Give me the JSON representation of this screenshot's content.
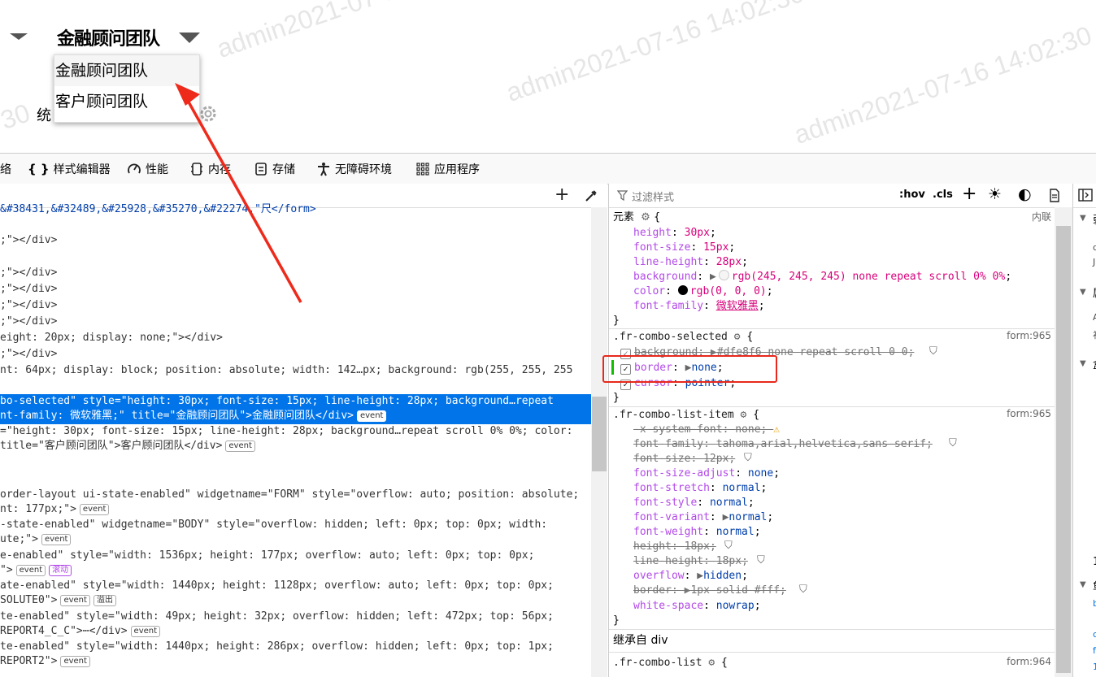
{
  "app": {
    "watermark": "admin2021-07-16 14:02:30",
    "watermark_fragment": "30",
    "combo_title": "金融顾问团队",
    "combo_options": [
      "金融顾问团队",
      "客户顾问团队"
    ],
    "stat_label_partial": "统"
  },
  "devtools": {
    "tabs": [
      {
        "label": "络",
        "icon": "network-icon"
      },
      {
        "label": "样式编辑器",
        "icon": "style-editor-icon"
      },
      {
        "label": "性能",
        "icon": "performance-icon"
      },
      {
        "label": "内存",
        "icon": "memory-icon"
      },
      {
        "label": "存储",
        "icon": "storage-icon"
      },
      {
        "label": "无障碍环境",
        "icon": "accessibility-icon"
      },
      {
        "label": "应用程序",
        "icon": "application-icon"
      }
    ],
    "filter_placeholder": "过滤样式",
    "hov_label": ":hov",
    "cls_label": ".cls",
    "html_lines": [
      "&#38431,&#32489,&#25928,&#35270,&#22274,\"尺</form>",
      ";\"></div>",
      "",
      ";\"></div>",
      ";\"></div>",
      ";\"></div>",
      ";\"></div>",
      "eight: 20px; display: none;\"></div>",
      ";\"></div>",
      "nt: 64px; display: block; position: absolute; width: 142…px; background: rgb(255, 255, 255",
      "",
      "bo-selected\" style=\"height: 30px; font-size: 15px; line-height: 28px; background…repeat",
      "nt-family: 微软雅黑;\" title=\"金融顾问团队\">金融顾问团队</div>",
      "=\"height: 30px; font-size: 15px; line-height: 28px; background…repeat scroll 0% 0%; color:",
      "title=\"客户顾问团队\">客户顾问团队</div>",
      "",
      "",
      "order-layout ui-state-enabled\" widgetname=\"FORM\" style=\"overflow: auto; position: absolute;",
      "nt: 177px;\">",
      "-state-enabled\" widgetname=\"BODY\" style=\"overflow: hidden; left: 0px; top: 0px; width:",
      "ute;\">",
      "e-enabled\" style=\"width: 1536px; height: 177px; overflow: auto; left: 0px; top: 0px;",
      "\">",
      "ate-enabled\" style=\"width: 1440px; height: 1128px; overflow: auto; left: 0px; top: 0px;",
      "SOLUTE0\">",
      "te-enabled\" style=\"width: 49px; height: 32px; overflow: hidden; left: 472px; top: 56px;",
      "REPORT4_C_C\">⋯</div>",
      "te-enabled\" style=\"width: 1440px; height: 286px; overflow: hidden; left: 0px; top: 1px;",
      "REPORT2\">"
    ],
    "badges": {
      "event": "event",
      "scroll": "滚动",
      "overflow": "溢出"
    },
    "rules": {
      "element_label": "元素",
      "inline_label": "内联",
      "element_props": [
        {
          "prop": "height",
          "value": "30px"
        },
        {
          "prop": "font-size",
          "value": "15px"
        },
        {
          "prop": "line-height",
          "value": "28px"
        },
        {
          "prop": "background",
          "value": "rgb(245, 245, 245) none repeat scroll 0% 0%"
        },
        {
          "prop": "color",
          "value": "rgb(0, 0, 0)"
        },
        {
          "prop": "font-family",
          "value": "微软雅黑"
        }
      ],
      "selected_rule": {
        "selector": ".fr-combo-selected",
        "source": "form:965",
        "props": [
          {
            "prop": "background",
            "value": "#dfe8f6 none repeat scroll 0 0",
            "struck": true
          },
          {
            "prop": "border",
            "value": "none"
          },
          {
            "prop": "cursor",
            "value": "pointer"
          }
        ]
      },
      "list_item_rule": {
        "selector": ".fr-combo-list-item",
        "source": "form:965",
        "props": [
          {
            "prop": "-x-system-font",
            "value": "none",
            "struck": true
          },
          {
            "prop": "font-family",
            "value": "tahoma,arial,helvetica,sans-serif",
            "struck": true
          },
          {
            "prop": "font-size",
            "value": "12px",
            "struck": true
          },
          {
            "prop": "font-size-adjust",
            "value": "none"
          },
          {
            "prop": "font-stretch",
            "value": "normal"
          },
          {
            "prop": "font-style",
            "value": "normal"
          },
          {
            "prop": "font-variant",
            "value": "normal"
          },
          {
            "prop": "font-weight",
            "value": "normal"
          },
          {
            "prop": "height",
            "value": "18px",
            "struck": true
          },
          {
            "prop": "line-height",
            "value": "18px",
            "struck": true
          },
          {
            "prop": "overflow",
            "value": "hidden"
          },
          {
            "prop": "border",
            "value": "1px solid #fff",
            "struck": true
          },
          {
            "prop": "white-space",
            "value": "nowrap"
          }
        ]
      },
      "inherited_label": "继承自 div",
      "combo_list_rule": {
        "selector": ".fr-combo-list",
        "source": "form:964"
      }
    },
    "side_fragments": [
      "弱",
      "d",
      "J",
      "属",
      "A",
      "礼",
      "盒",
      "1",
      "鱼",
      "b",
      "c",
      "f",
      "1"
    ]
  },
  "colors": {
    "selection": "#0074e8",
    "annotation": "#e8281c"
  }
}
